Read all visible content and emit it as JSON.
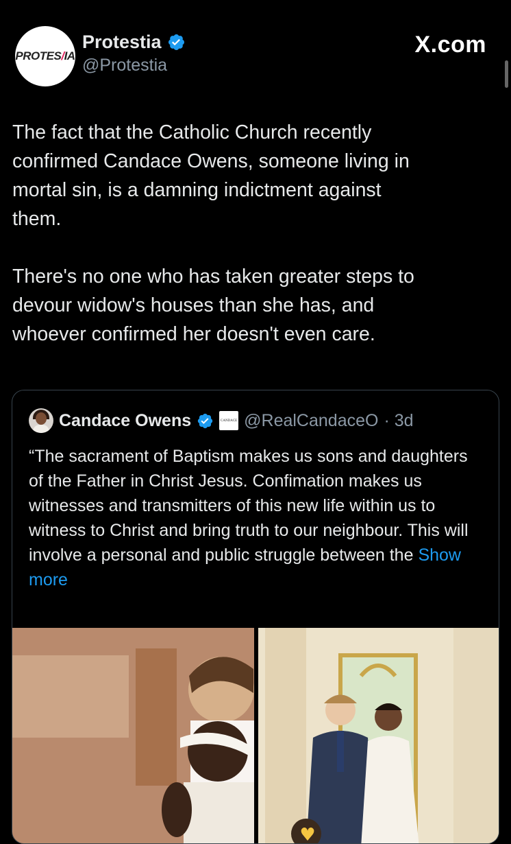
{
  "header": {
    "avatar_logo_text": "PROTES/IA",
    "display_name": "Protestia",
    "handle": "@Protestia",
    "brand": "X.com"
  },
  "tweet": {
    "text": "The fact that the Catholic Church recently\nconfirmed Candace Owens, someone living in\nmortal sin, is a damning indictment against\nthem.\n\nThere's no one who has taken greater steps to\ndevour widow's houses than she has, and\nwhoever confirmed her doesn't even care."
  },
  "quoted": {
    "display_name": "Candace Owens",
    "badge_text": "CANDACE",
    "handle": "@RealCandaceO",
    "time": "· 3d",
    "text": "“The sacrament of Baptism makes us sons and daughters of the Father in Christ Jesus. Confimation makes us witnesses and transmitters of this new life within us to witness to Christ and bring truth to our neighbour. This will involve a personal and public struggle between the ",
    "show_more": "Show more"
  },
  "colors": {
    "background": "#000000",
    "text": "#e7e9ea",
    "muted": "#8b98a5",
    "link": "#1d9bf0",
    "verified": "#1d9bf0",
    "border": "#38444d"
  },
  "icons": [
    "verified-badge-icon",
    "x-logo"
  ]
}
